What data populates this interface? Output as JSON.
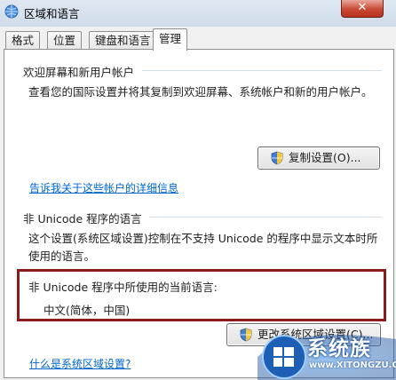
{
  "window": {
    "title": "区域和语言",
    "close_label": "✕"
  },
  "tabs": [
    {
      "label": "格式",
      "active": false
    },
    {
      "label": "位置",
      "active": false
    },
    {
      "label": "键盘和语言",
      "active": false
    },
    {
      "label": "管理",
      "active": true
    }
  ],
  "welcome": {
    "title": "欢迎屏幕和新用户帐户",
    "description": "查看您的国际设置并将其复制到欢迎屏幕、系统帐户和新的用户帐户。",
    "copy_button": "复制设置(O)...",
    "link": "告诉我关于这些帐户的详细信息"
  },
  "non_unicode": {
    "title": "非 Unicode 程序的语言",
    "description": "这个设置(系统区域设置)控制在不支持 Unicode 的程序中显示文本时所使用的语言。",
    "current_label": "非 Unicode 程序中所使用的当前语言:",
    "current_value": "中文(简体，中国)",
    "change_button": "更改系统区域设置(C)...",
    "link": "什么是系统区域设置?"
  },
  "watermark": {
    "text": "系统族",
    "url": "www.XITONGZU.COM"
  },
  "colors": {
    "link": "#0066cc",
    "highlight_border": "#8b1a1a",
    "close": "#c94a35"
  }
}
